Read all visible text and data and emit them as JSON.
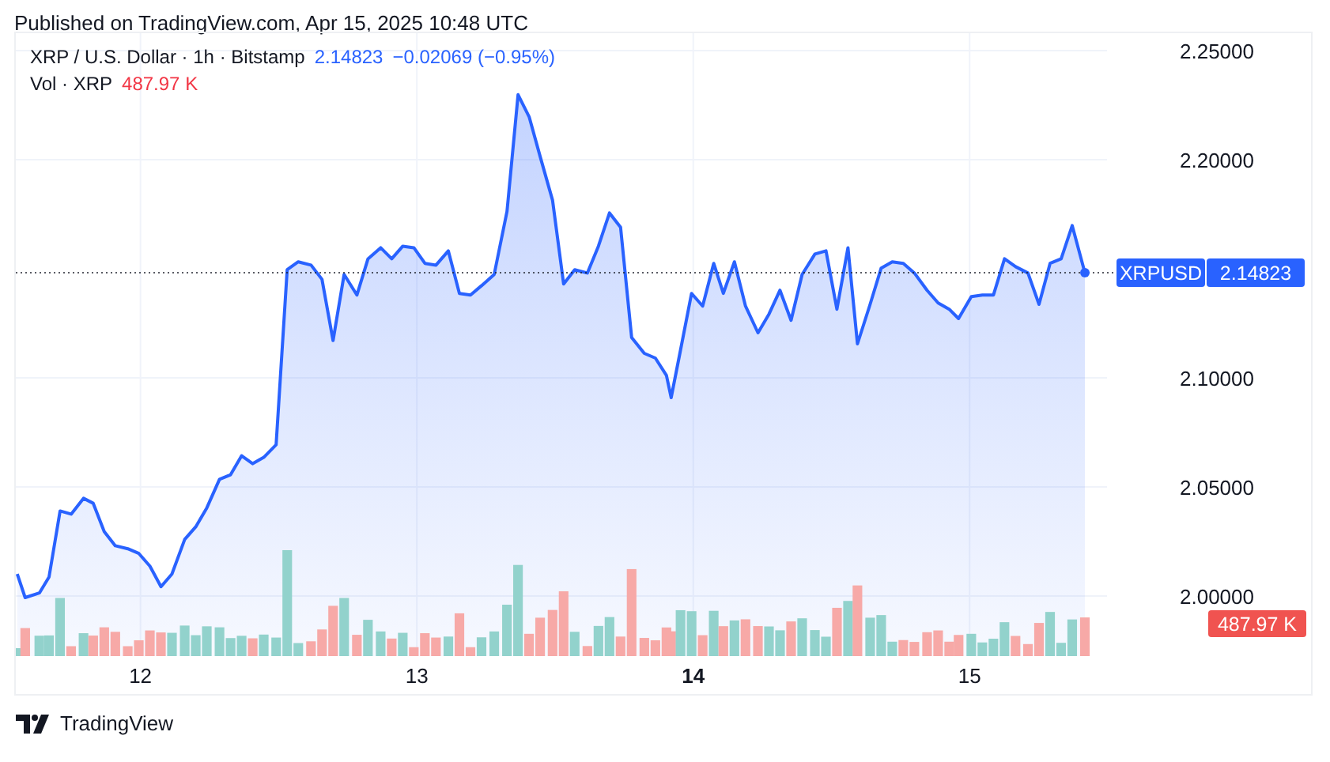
{
  "header": {
    "published": "Published on TradingView.com, Apr 15, 2025 10:48 UTC"
  },
  "legend": {
    "title": "XRP / U.S. Dollar · 1h · Bitstamp",
    "last": "2.14823",
    "change": "−0.02069 (−0.95%)",
    "volume_label": "Vol · XRP",
    "volume_value": "487.97 K"
  },
  "badges": {
    "price": "2.14823",
    "volume": "487.97 K"
  },
  "time_axis": [
    {
      "label": "12",
      "bold": false
    },
    {
      "label": "13",
      "bold": false
    },
    {
      "label": "14",
      "bold": true
    },
    {
      "label": "15",
      "bold": false
    }
  ],
  "chart_data": {
    "type": "area",
    "grid": true,
    "xlim": [
      11.549,
      15.497
    ],
    "ylim": [
      1.9725,
      2.258
    ],
    "xticks": [
      12,
      13,
      14,
      15
    ],
    "ref_lines": [
      {
        "axis": "y",
        "value": 2.1482
      }
    ],
    "yticks": [
      {
        "value": 2.0,
        "label": "2.00000"
      },
      {
        "value": 2.05,
        "label": "2.05000"
      },
      {
        "value": 2.1,
        "label": "2.10000"
      },
      {
        "value": 2.2,
        "label": "2.20000"
      },
      {
        "value": 2.25,
        "label": "2.25000"
      }
    ],
    "x": [
      11.554,
      11.583,
      11.634,
      11.669,
      11.709,
      11.749,
      11.794,
      11.829,
      11.869,
      11.909,
      11.954,
      11.994,
      12.034,
      12.074,
      12.114,
      12.16,
      12.2,
      12.24,
      12.286,
      12.326,
      12.366,
      12.406,
      12.446,
      12.491,
      12.531,
      12.571,
      12.617,
      12.657,
      12.697,
      12.737,
      12.783,
      12.823,
      12.869,
      12.909,
      12.949,
      12.989,
      13.029,
      13.069,
      13.114,
      13.154,
      13.194,
      13.234,
      13.28,
      13.326,
      13.366,
      13.406,
      13.446,
      13.491,
      13.531,
      13.571,
      13.617,
      13.657,
      13.697,
      13.737,
      13.777,
      13.823,
      13.863,
      13.903,
      13.92,
      13.954,
      13.994,
      14.034,
      14.074,
      14.109,
      14.149,
      14.189,
      14.234,
      14.274,
      14.314,
      14.354,
      14.394,
      14.44,
      14.48,
      14.52,
      14.56,
      14.594,
      14.64,
      14.68,
      14.72,
      14.76,
      14.8,
      14.846,
      14.886,
      14.926,
      14.96,
      15.006,
      15.046,
      15.086,
      15.126,
      15.166,
      15.211,
      15.251,
      15.291,
      15.331,
      15.371,
      15.417
    ],
    "series": [
      {
        "name": "XRPUSD",
        "color": "#2962ff",
        "values": [
          2.0101,
          1.9993,
          2.0014,
          2.0087,
          2.039,
          2.0376,
          2.0448,
          2.0426,
          2.0296,
          2.0231,
          2.0217,
          2.0195,
          2.0137,
          2.0043,
          2.0101,
          2.026,
          2.0318,
          2.0405,
          2.0535,
          2.0556,
          2.0643,
          2.0607,
          2.0636,
          2.0694,
          2.1496,
          2.1532,
          2.1517,
          2.1452,
          2.1171,
          2.1474,
          2.138,
          2.1546,
          2.1597,
          2.1546,
          2.1604,
          2.1597,
          2.1525,
          2.1517,
          2.1582,
          2.1387,
          2.138,
          2.1423,
          2.1474,
          2.1763,
          2.2298,
          2.2197,
          2.2016,
          2.1814,
          2.1431,
          2.1496,
          2.1481,
          2.1604,
          2.1756,
          2.1691,
          2.1185,
          2.1113,
          2.1091,
          2.1012,
          2.091,
          2.1127,
          2.1387,
          2.1329,
          2.1525,
          2.1387,
          2.1532,
          2.1329,
          2.1207,
          2.1293,
          2.1402,
          2.1264,
          2.1474,
          2.1568,
          2.1582,
          2.1315,
          2.1597,
          2.1156,
          2.1337,
          2.1503,
          2.1532,
          2.1525,
          2.1481,
          2.1402,
          2.1344,
          2.1315,
          2.1272,
          2.1373,
          2.138,
          2.138,
          2.1546,
          2.151,
          2.1481,
          2.1337,
          2.1525,
          2.1546,
          2.1698,
          2.1482
        ]
      }
    ]
  },
  "footer": {
    "brand": "TradingView"
  }
}
